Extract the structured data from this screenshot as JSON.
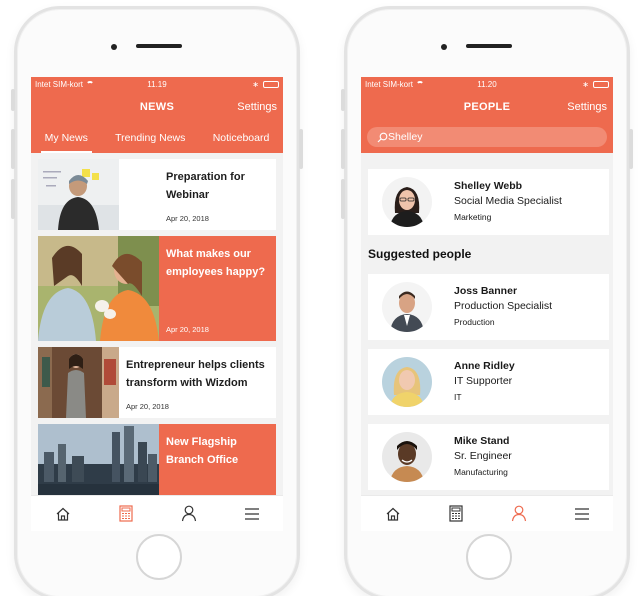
{
  "left_phone": {
    "status": {
      "carrier": "Intet SIM-kort",
      "time": "11.19"
    },
    "title": "NEWS",
    "settings_label": "Settings",
    "tabs": [
      {
        "label": "My News",
        "active": true
      },
      {
        "label": "Trending News",
        "active": false
      },
      {
        "label": "Noticeboard",
        "active": false
      }
    ],
    "articles": [
      {
        "headline": "Preparation for Webinar",
        "date": "Apr 20, 2018"
      },
      {
        "headline": "What makes our employees happy?",
        "date": "Apr 20, 2018"
      },
      {
        "headline": "Entrepreneur helps clients transform with Wizdom",
        "date": "Apr 20, 2018"
      },
      {
        "headline": "New Flagship Branch Office",
        "date": ""
      }
    ]
  },
  "right_phone": {
    "status": {
      "carrier": "Intet SIM-kort",
      "time": "11.20"
    },
    "title": "PEOPLE",
    "settings_label": "Settings",
    "search": {
      "value": "Shelley"
    },
    "current_user": {
      "name": "Shelley Webb",
      "title": "Social Media Specialist",
      "department": "Marketing"
    },
    "suggested_title": "Suggested people",
    "suggested": [
      {
        "name": "Joss Banner",
        "title": "Production Specialist",
        "department": "Production"
      },
      {
        "name": "Anne Ridley",
        "title": "IT Supporter",
        "department": "IT"
      },
      {
        "name": "Mike Stand",
        "title": "Sr. Engineer",
        "department": "Manufacturing"
      }
    ]
  },
  "tabbar_icons": [
    "home-icon",
    "news-icon",
    "people-icon",
    "menu-icon"
  ],
  "colors": {
    "accent": "#ee6a4e",
    "accent_light": "#f28b74",
    "background": "#f2f2f2",
    "card": "#ffffff"
  }
}
